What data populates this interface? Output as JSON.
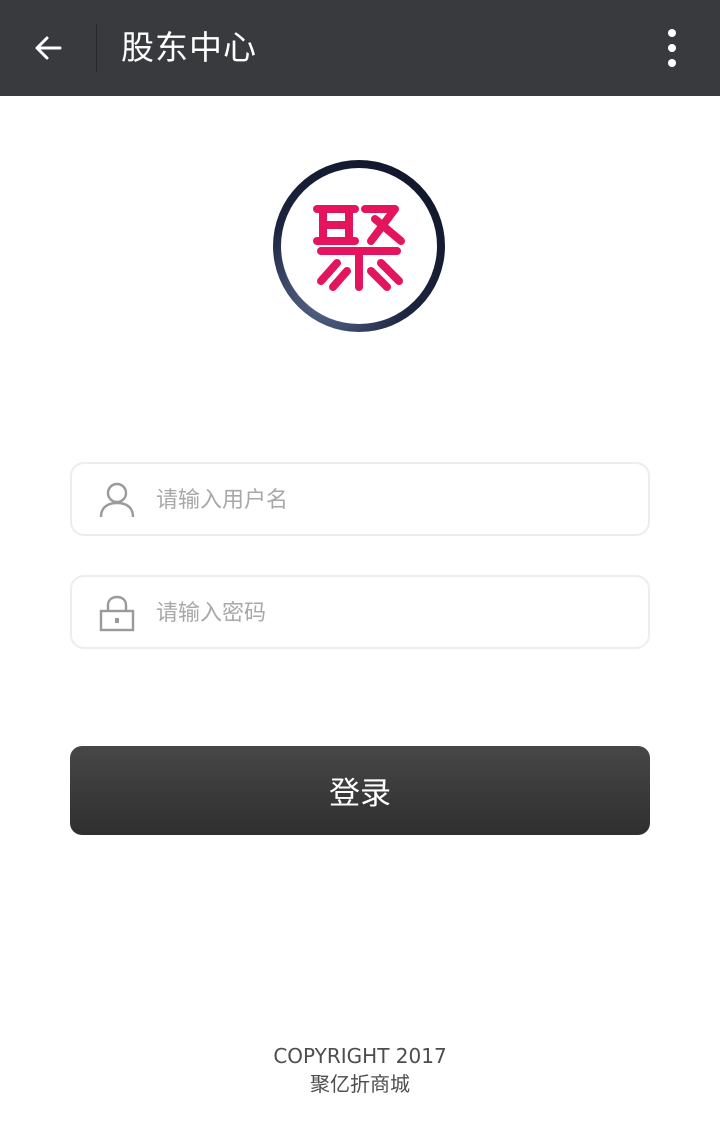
{
  "header": {
    "title": "股东中心",
    "back_icon": "arrow-left-icon",
    "more_icon": "vertical-dots-icon",
    "background": "#383a3e"
  },
  "logo": {
    "glyph": "聚",
    "color": "#e5145e"
  },
  "form": {
    "username": {
      "placeholder": "请输入用户名",
      "value": "",
      "icon": "user-icon"
    },
    "password": {
      "placeholder": "请输入密码",
      "value": "",
      "icon": "lock-icon"
    },
    "login_label": "登录"
  },
  "footer": {
    "copyright": "COPYRIGHT 2017",
    "company": "聚亿折商城"
  }
}
